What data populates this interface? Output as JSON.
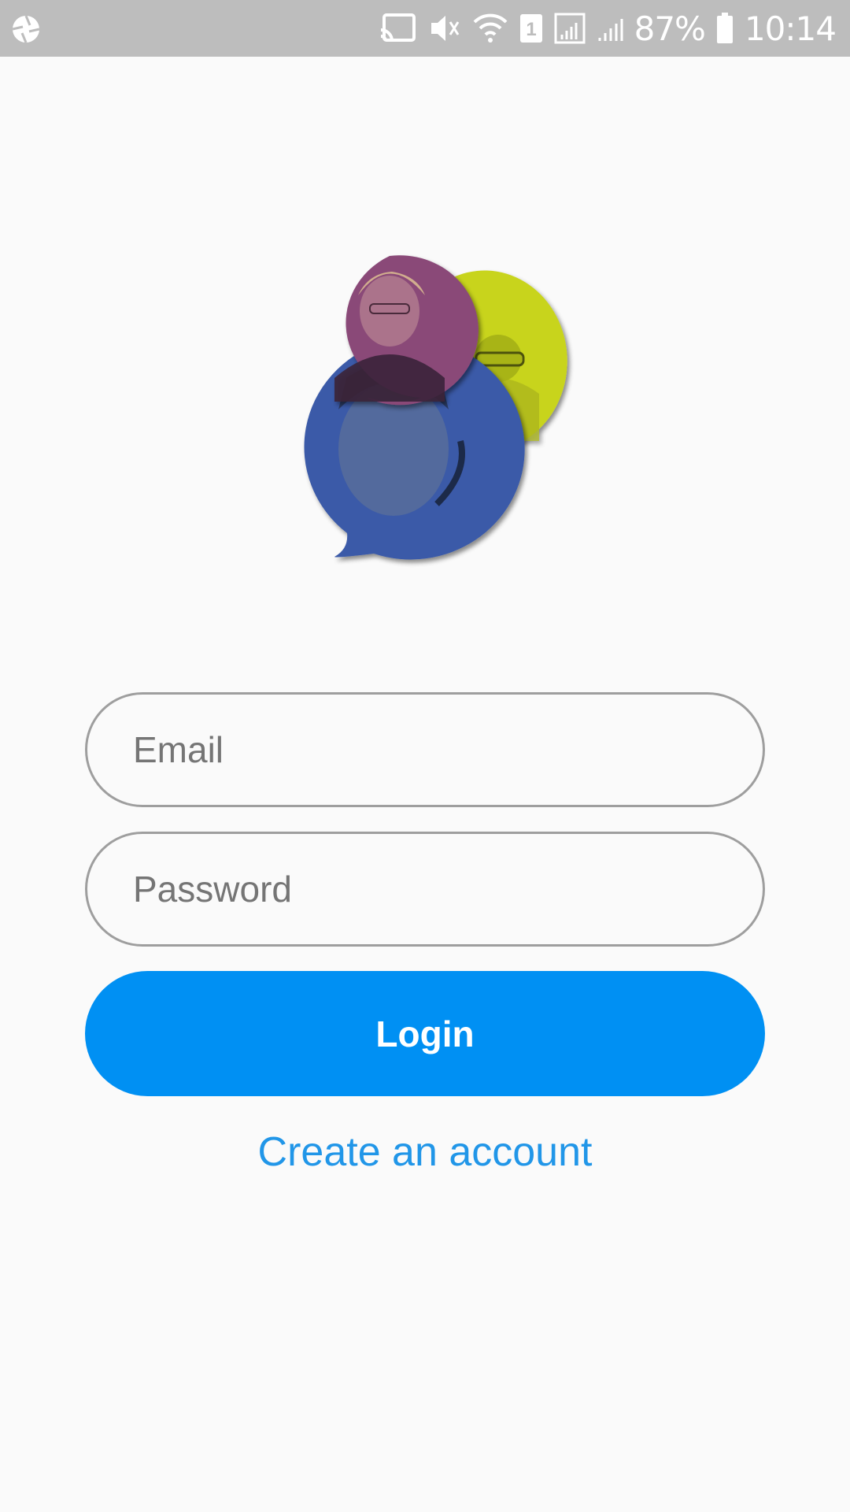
{
  "status_bar": {
    "battery_percent": "87%",
    "time": "10:14",
    "sim_slot": "1",
    "icons": [
      "aperture-icon",
      "cast-icon",
      "mute-icon",
      "wifi-icon",
      "sim-icon",
      "signal-icon",
      "signal-icon",
      "battery-icon"
    ]
  },
  "logo": {
    "bubbles": [
      {
        "name": "yellow-bubble",
        "color": "#c8d41e"
      },
      {
        "name": "blue-bubble",
        "color": "#3a5aa8"
      },
      {
        "name": "purple-bubble",
        "color": "#8a4a78"
      }
    ]
  },
  "form": {
    "email_placeholder": "Email",
    "password_placeholder": "Password",
    "login_label": "Login",
    "create_account_label": "Create an account"
  },
  "colors": {
    "accent": "#0090f3",
    "link": "#2196e8",
    "background": "#fafafa",
    "status_bar": "#bdbdbd"
  }
}
